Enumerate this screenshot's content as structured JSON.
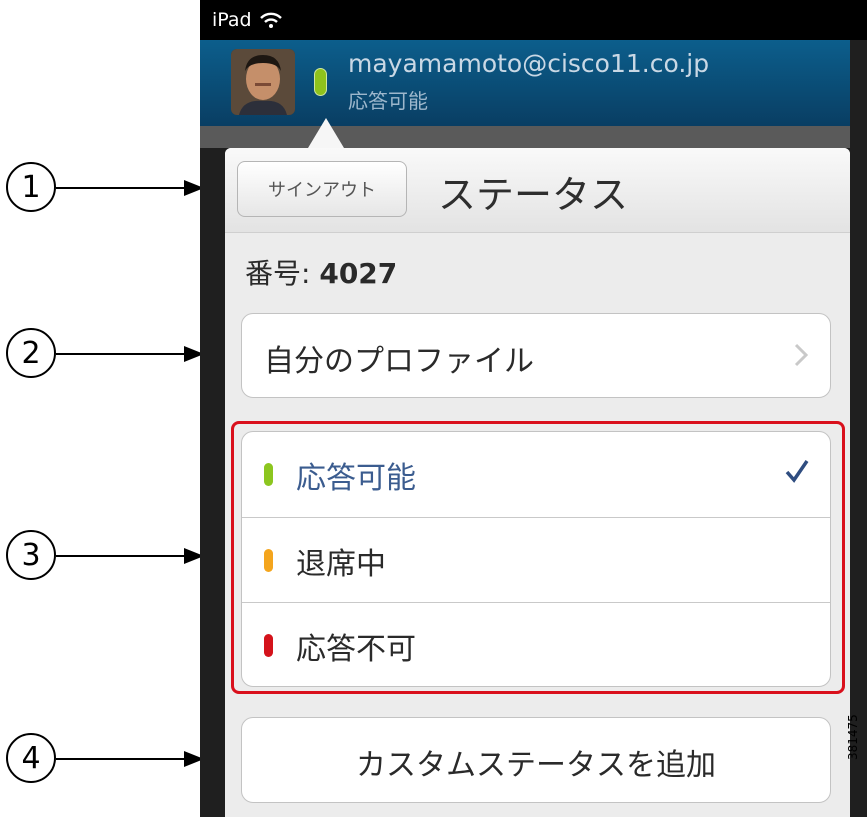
{
  "callouts": [
    "1",
    "2",
    "3",
    "4"
  ],
  "status_bar": {
    "device": "iPad"
  },
  "account": {
    "email": "mayamamoto@cisco11.co.jp",
    "status": "応答可能"
  },
  "panel": {
    "signout_label": "サインアウト",
    "title": "ステータス",
    "number_label": "番号:",
    "number_value": "4027",
    "profile_label": "自分のプロファイル",
    "statuses": [
      {
        "label": "応答可能",
        "color": "#8cc61f",
        "selected": true
      },
      {
        "label": "退席中",
        "color": "#f4a51d",
        "selected": false
      },
      {
        "label": "応答不可",
        "color": "#d4131b",
        "selected": false
      }
    ],
    "add_custom_label": "カスタムステータスを追加"
  },
  "figure_id": "381475"
}
